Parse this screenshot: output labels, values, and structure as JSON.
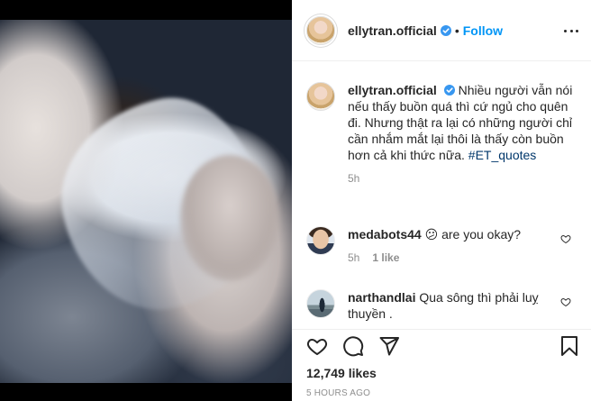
{
  "post": {
    "username": "ellytran.official",
    "follow_label": "Follow",
    "separator": "•"
  },
  "caption": {
    "username": "ellytran.official",
    "text": "Nhiều người vẫn nói nếu thấy buồn quá thì cứ ngủ cho quên đi. Nhưng thật ra lại có những người chỉ cần nhắm mắt lại thôi là thấy còn buồn hơn cả khi thức nữa.",
    "hashtag": "#ET_quotes",
    "time": "5h"
  },
  "comments": [
    {
      "username": "medabots44",
      "text": "😕 are you okay?",
      "time": "5h",
      "likes": "1 like"
    },
    {
      "username": "narthandlai",
      "text": "Qua sông thì phải luỵ thuyền .",
      "time": "",
      "likes": ""
    }
  ],
  "actions": {
    "likes": "12,749 likes",
    "posted": "5 HOURS AGO"
  },
  "icons": [
    "verified-badge-icon",
    "more-options-icon",
    "heart-icon",
    "comment-icon",
    "share-icon",
    "bookmark-icon"
  ],
  "colors": {
    "accent": "#0095f6",
    "text": "#262626",
    "muted": "#8e8e8e",
    "border": "#efefef"
  }
}
